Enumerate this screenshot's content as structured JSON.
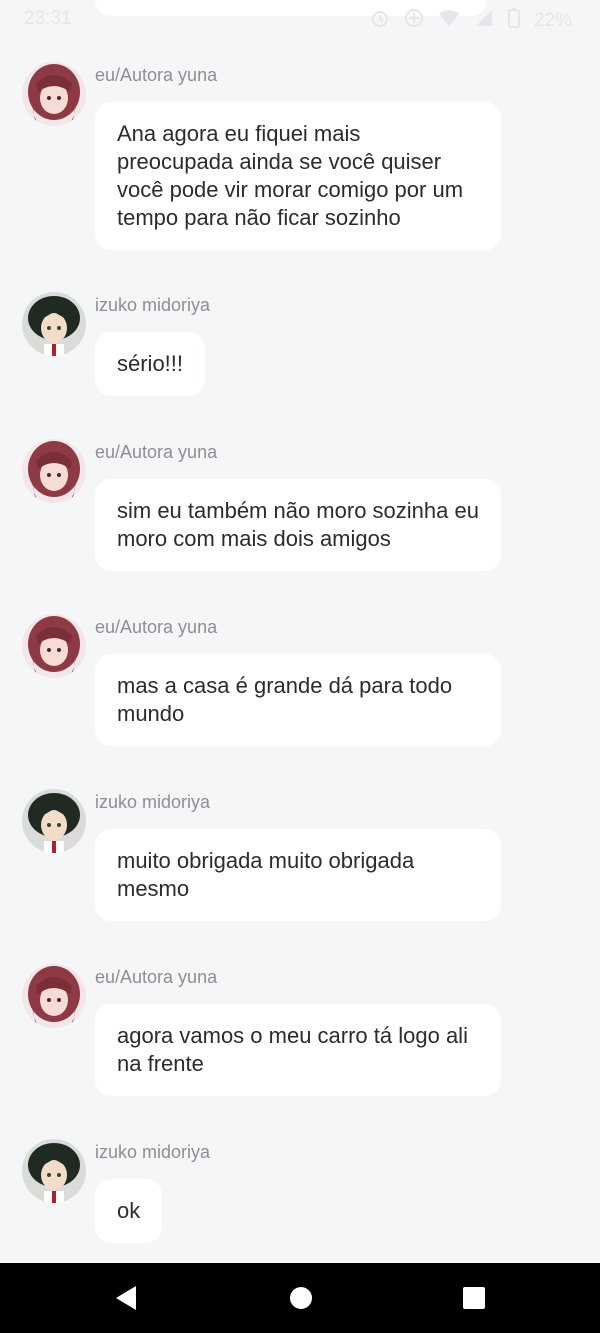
{
  "status_bar": {
    "time": "23:31",
    "battery": "22%",
    "icons": [
      "alarm-icon",
      "data-saver-icon",
      "wifi-icon",
      "signal-icon",
      "battery-icon"
    ]
  },
  "messages": [
    {
      "sender": "eu/Autora yuna",
      "avatar": "yuna-avatar",
      "text": "Ana agora eu fiquei mais preocupada ainda se você quiser você pode vir morar comigo por um tempo para não ficar sozinho"
    },
    {
      "sender": "izuko midoriya",
      "avatar": "midoriya-avatar",
      "text": "sério!!!"
    },
    {
      "sender": "eu/Autora yuna",
      "avatar": "yuna-avatar",
      "text": "sim eu também não moro sozinha eu moro com mais dois amigos"
    },
    {
      "sender": "eu/Autora yuna",
      "avatar": "yuna-avatar",
      "text": "mas a casa é grande dá para todo mundo"
    },
    {
      "sender": "izuko midoriya",
      "avatar": "midoriya-avatar",
      "text": "muito obrigada muito obrigada mesmo"
    },
    {
      "sender": "eu/Autora yuna",
      "avatar": "yuna-avatar",
      "text": "agora vamos o meu carro tá logo ali na frente"
    },
    {
      "sender": "izuko midoriya",
      "avatar": "midoriya-avatar",
      "text": "ok"
    }
  ],
  "nav_bar": {
    "buttons": [
      "back-icon",
      "home-icon",
      "recent-apps-icon"
    ]
  },
  "colors": {
    "background": "#f5f6f8",
    "bubble": "#ffffff",
    "sender": "#8d8f94",
    "text": "#2b2c30",
    "yuna_hair": "#8e3a44",
    "midoriya_hair": "#1f2a22"
  }
}
